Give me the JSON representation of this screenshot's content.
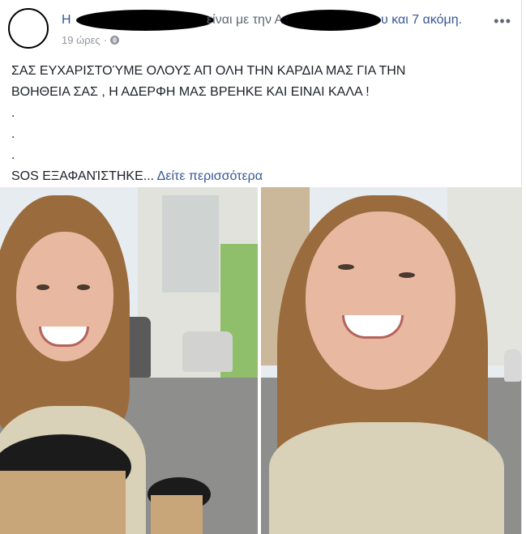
{
  "post": {
    "header": {
      "name_start": "H",
      "middle_text": "είναι με την Α",
      "end_text": "υ και 7 ακόμη."
    },
    "time": "19 ώρες",
    "more_icon": "ellipsis-icon",
    "privacy_icon": "globe-icon",
    "text_lines": [
      "ΣΑΣ ΕΥΧΑΡΙΣΤΟΎΜΕ ΟΛΟΥΣ ΑΠ ΟΛΗ ΤΗΝ ΚΑΡΔΙΑ ΜΑΣ ΓΙΑ ΤΗΝ",
      "ΒΟΗΘΕΙΑ ΣΑΣ , Η ΑΔΕΡΦΗ ΜΑΣ ΒΡΕΗΚΕ ΚΑΙ ΕΙΝΑΙ ΚΑΛΑ !",
      ".",
      ".",
      "."
    ],
    "last_line": "SOS ΕΞΑΦΑΝΊΣΤΗΚΕ...",
    "see_more": "Δείτε περισσότερα"
  }
}
